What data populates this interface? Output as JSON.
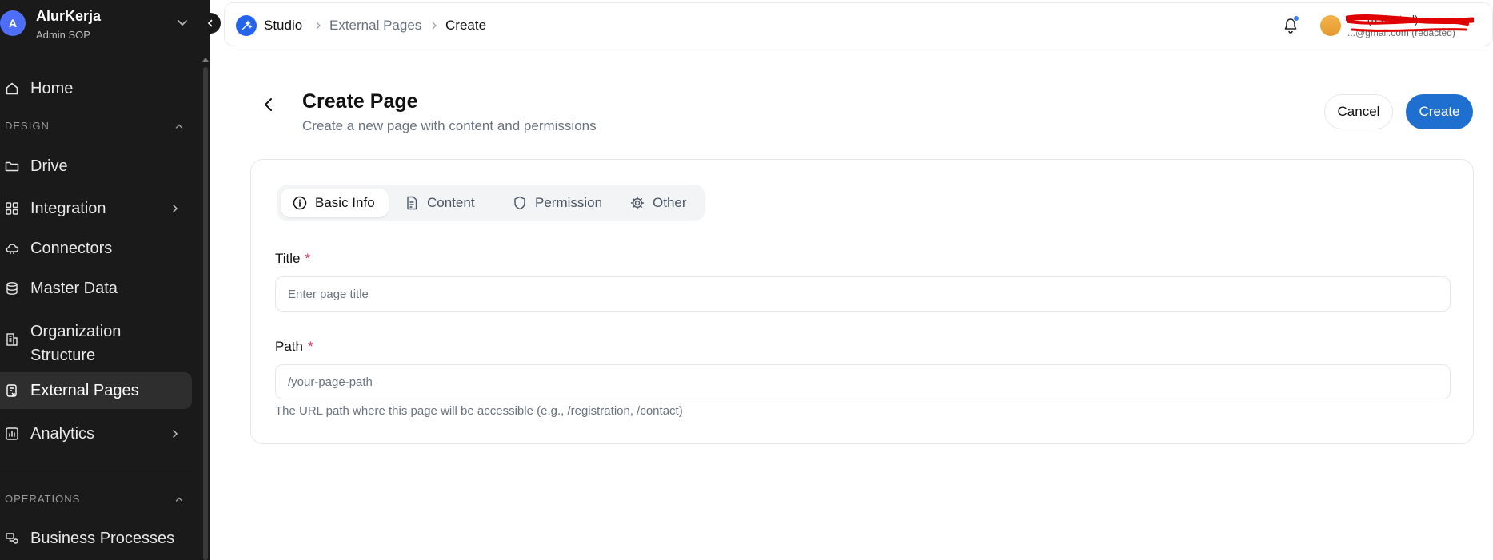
{
  "workspace": {
    "initial": "A",
    "name": "AlurKerja",
    "role": "Admin SOP"
  },
  "sidebar": {
    "home": "Home",
    "design_header": "DESIGN",
    "design_items": [
      {
        "label": "Drive",
        "icon": "folder-icon"
      },
      {
        "label": "Integration",
        "icon": "grid-icon"
      },
      {
        "label": "Connectors",
        "icon": "cloud-icon"
      },
      {
        "label": "Master Data",
        "icon": "database-icon"
      },
      {
        "label": "Organization Structure",
        "icon": "building-icon"
      },
      {
        "label": "External Pages",
        "icon": "external-page-icon",
        "active": true
      },
      {
        "label": "Analytics",
        "icon": "analytics-icon"
      }
    ],
    "operations_header": "OPERATIONS",
    "operations_items": [
      {
        "label": "Business Processes",
        "icon": "process-icon"
      }
    ]
  },
  "breadcrumb": {
    "studio": "Studio",
    "external_pages": "External Pages",
    "current": "Create"
  },
  "user": {
    "name": "A... (redacted)",
    "email": "...@gmail.com (redacted)"
  },
  "header": {
    "title": "Create Page",
    "subtitle": "Create a new page with content and permissions",
    "cancel_label": "Cancel",
    "create_label": "Create"
  },
  "tabs": [
    "Basic Info",
    "Content",
    "Permission",
    "Other"
  ],
  "form": {
    "title_label": "Title",
    "title_placeholder": "Enter page title",
    "path_label": "Path",
    "path_placeholder": "/your-page-path",
    "required_mark": "*",
    "path_helper": "The URL path where this page will be accessible (e.g., /registration, /contact)"
  },
  "colors": {
    "primary": "#1f6fd1",
    "sidebar_bg": "#1a1a1a",
    "required": "#e11d48"
  }
}
